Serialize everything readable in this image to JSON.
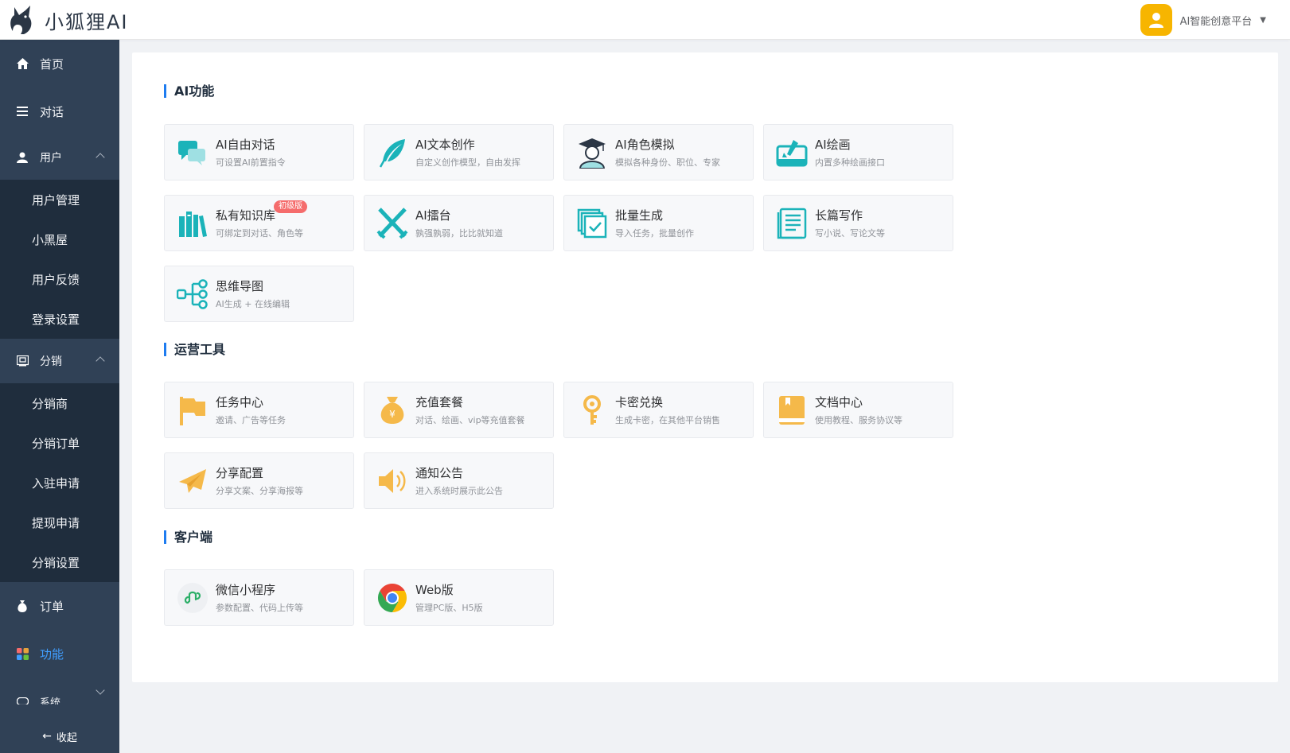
{
  "header": {
    "logo_text": "小狐狸AI",
    "user_name": "AI智能创意平台"
  },
  "sidebar": {
    "home": "首页",
    "chat": "对话",
    "user": "用户",
    "user_sub": [
      "用户管理",
      "小黑屋",
      "用户反馈",
      "登录设置"
    ],
    "distribution": "分销",
    "distribution_sub": [
      "分销商",
      "分销订单",
      "入驻申请",
      "提现申请",
      "分销设置"
    ],
    "order": "订单",
    "function": "功能",
    "system": "系统",
    "collapse": "收起"
  },
  "sections": {
    "ai": "AI功能",
    "ops": "运营工具",
    "client": "客户端"
  },
  "ai_cards": [
    {
      "title": "AI自由对话",
      "desc": "可设置AI前置指令",
      "icon": "chat-bubble-icon"
    },
    {
      "title": "AI文本创作",
      "desc": "自定义创作模型，自由发挥",
      "icon": "feather-icon"
    },
    {
      "title": "AI角色模拟",
      "desc": "模拟各种身份、职位、专家",
      "icon": "graduate-icon"
    },
    {
      "title": "AI绘画",
      "desc": "内置多种绘画接口",
      "icon": "paint-icon"
    },
    {
      "title": "私有知识库",
      "desc": "可绑定到对话、角色等",
      "icon": "books-icon",
      "badge": "初级版"
    },
    {
      "title": "AI擂台",
      "desc": "孰强孰弱，比比就知道",
      "icon": "swords-icon"
    },
    {
      "title": "批量生成",
      "desc": "导入任务，批量创作",
      "icon": "batch-icon"
    },
    {
      "title": "长篇写作",
      "desc": "写小说、写论文等",
      "icon": "document-lines-icon"
    },
    {
      "title": "思维导图",
      "desc": "AI生成 + 在线编辑",
      "icon": "mindmap-icon"
    }
  ],
  "ops_cards": [
    {
      "title": "任务中心",
      "desc": "邀请、广告等任务",
      "icon": "flag-icon"
    },
    {
      "title": "充值套餐",
      "desc": "对话、绘画、vip等充值套餐",
      "icon": "money-bag-icon"
    },
    {
      "title": "卡密兑换",
      "desc": "生成卡密，在其他平台销售",
      "icon": "key-icon"
    },
    {
      "title": "文档中心",
      "desc": "使用教程、服务协议等",
      "icon": "book-icon"
    },
    {
      "title": "分享配置",
      "desc": "分享文案、分享海报等",
      "icon": "paper-plane-icon"
    },
    {
      "title": "通知公告",
      "desc": "进入系统时展示此公告",
      "icon": "speaker-icon"
    }
  ],
  "client_cards": [
    {
      "title": "微信小程序",
      "desc": "参数配置、代码上传等",
      "icon": "mini-program-icon"
    },
    {
      "title": "Web版",
      "desc": "管理PC版、H5版",
      "icon": "chrome-icon"
    }
  ],
  "colors": {
    "sidebar_bg": "#304156",
    "submenu_bg": "#1f2d3d",
    "accent": "#409eff",
    "teal": "#1bb3b9",
    "orange": "#f5b94a"
  }
}
